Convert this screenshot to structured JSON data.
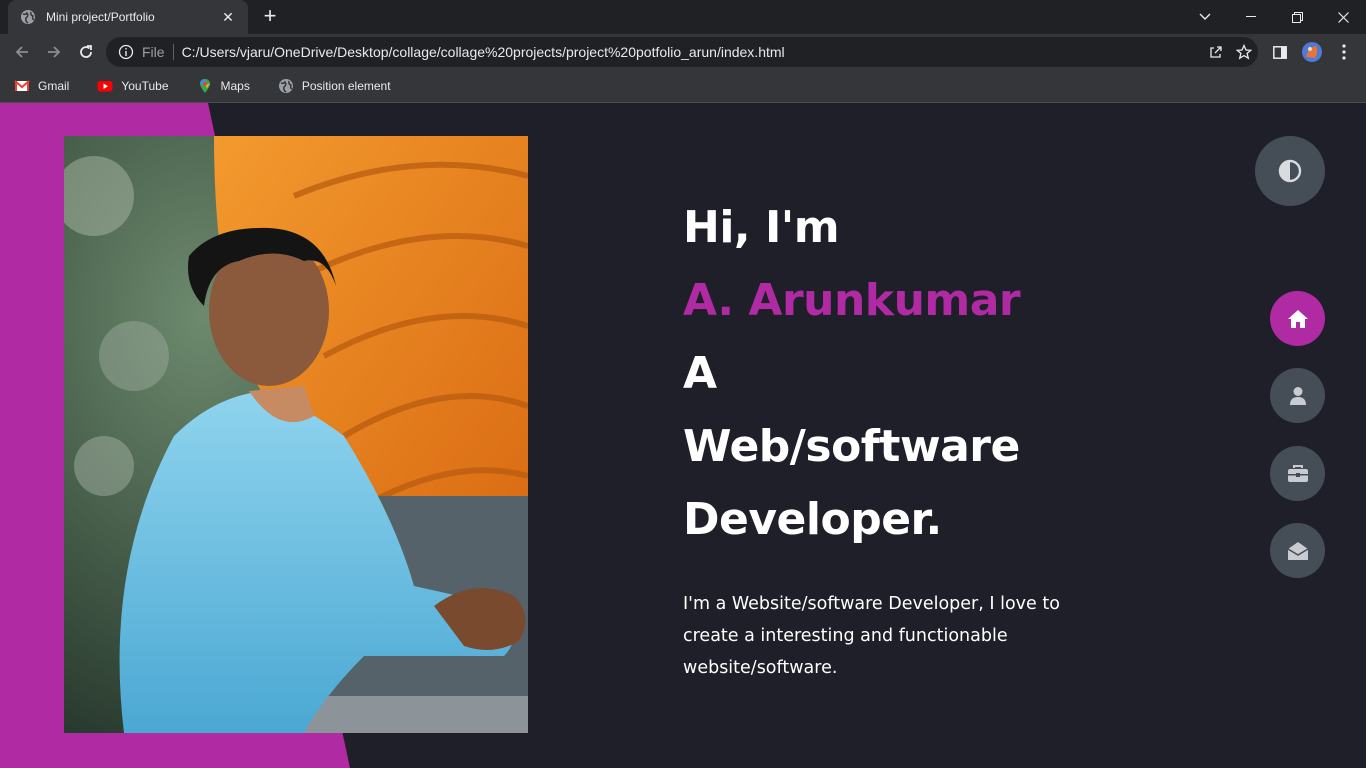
{
  "browser": {
    "tab_title": "Mini project/Portfolio",
    "url_scheme": "File",
    "url": "C:/Users/vjaru/OneDrive/Desktop/collage/collage%20projects/project%20potfolio_arun/index.html",
    "bookmarks": [
      {
        "label": "Gmail",
        "icon": "gmail-icon"
      },
      {
        "label": "YouTube",
        "icon": "youtube-icon"
      },
      {
        "label": "Maps",
        "icon": "maps-icon"
      },
      {
        "label": "Position element",
        "icon": "globe-icon"
      }
    ]
  },
  "hero": {
    "line1": "Hi, I'm",
    "name": "A. Arunkumar",
    "line3": "A",
    "line4": "Web/software",
    "line5": "Developer.",
    "bio": "I'm a Website/software Developer, I love to create a interesting and functionable website/software."
  },
  "side_nav": [
    {
      "name": "home",
      "icon": "home-icon",
      "active": true
    },
    {
      "name": "about",
      "icon": "user-icon",
      "active": false
    },
    {
      "name": "portfolio",
      "icon": "briefcase-icon",
      "active": false
    },
    {
      "name": "contact",
      "icon": "envelope-open-icon",
      "active": false
    }
  ],
  "theme_toggle_icon": "contrast-icon",
  "colors": {
    "accent": "#b02aa3",
    "page_background": "#1e1f29",
    "button_background": "#454e56",
    "text": "#ffffff"
  }
}
